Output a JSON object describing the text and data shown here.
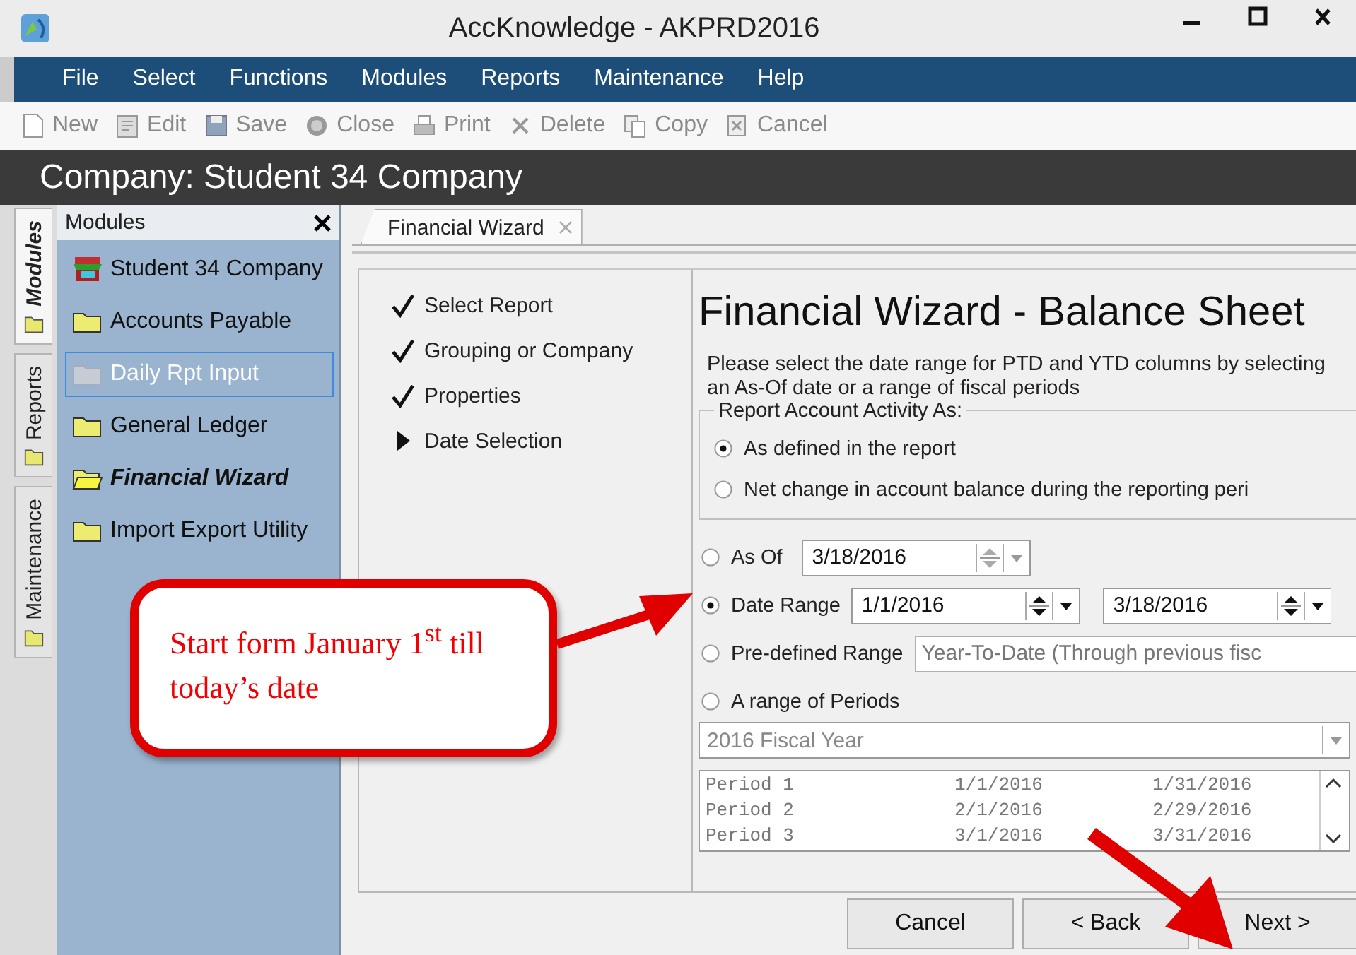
{
  "window": {
    "title": "AccKnowledge - AKPRD2016"
  },
  "menu": [
    "File",
    "Select",
    "Functions",
    "Modules",
    "Reports",
    "Maintenance",
    "Help"
  ],
  "toolbar": [
    {
      "label": "New",
      "kind": "new",
      "disabled": true
    },
    {
      "label": "Edit",
      "kind": "edit",
      "disabled": true
    },
    {
      "label": "Save",
      "kind": "save",
      "disabled": true
    },
    {
      "label": "Close",
      "kind": "close",
      "disabled": true
    },
    {
      "label": "Print",
      "kind": "print",
      "disabled": true
    },
    {
      "label": "Delete",
      "kind": "delete",
      "disabled": true
    },
    {
      "label": "Copy",
      "kind": "copy",
      "disabled": true
    },
    {
      "label": "Cancel",
      "kind": "cancel",
      "disabled": true
    }
  ],
  "company_bar": {
    "text": "Company: Student 34 Company"
  },
  "side_tabs": [
    {
      "label": "Modules",
      "selected": true
    },
    {
      "label": "Reports",
      "selected": false
    },
    {
      "label": "Maintenance",
      "selected": false
    }
  ],
  "sidebar": {
    "title": "Modules",
    "items": [
      {
        "label": "Student 34 Company",
        "kind": "company",
        "disabled": false,
        "selected": false,
        "focused": false
      },
      {
        "label": "Accounts Payable",
        "kind": "module",
        "disabled": false,
        "selected": false,
        "focused": false
      },
      {
        "label": "Daily Rpt Input",
        "kind": "module",
        "disabled": true,
        "selected": false,
        "focused": true
      },
      {
        "label": "General Ledger",
        "kind": "module",
        "disabled": false,
        "selected": false,
        "focused": false
      },
      {
        "label": "Financial Wizard",
        "kind": "module",
        "disabled": false,
        "selected": true,
        "focused": false
      },
      {
        "label": "Import Export Utility",
        "kind": "module",
        "disabled": false,
        "selected": false,
        "focused": false
      }
    ]
  },
  "doc_tab": {
    "label": "Financial Wizard",
    "selected": true
  },
  "steps": [
    {
      "label": "Select Report",
      "kind": "done"
    },
    {
      "label": "Grouping or Company",
      "kind": "done"
    },
    {
      "label": "Properties",
      "kind": "done"
    },
    {
      "label": "Date Selection",
      "kind": "current"
    }
  ],
  "wizard": {
    "title": "Financial Wizard - Balance Sheet",
    "instructions": "Please select the date range for PTD and YTD columns by selecting an As-Of date or a range of fiscal periods",
    "activity": {
      "legend": "Report Account Activity As:",
      "options": [
        {
          "label": "As defined in the report",
          "selected": true
        },
        {
          "label": "Net change in account balance during the reporting peri",
          "selected": false
        }
      ]
    },
    "date_options": [
      {
        "kind": "as_of",
        "label": "As Of",
        "selected": false,
        "value": "3/18/2016"
      },
      {
        "kind": "range",
        "label": "Date Range",
        "selected": true,
        "from": "1/1/2016",
        "to": "3/18/2016"
      },
      {
        "kind": "predefined",
        "label": "Pre-defined Range",
        "selected": false,
        "value": "Year-To-Date (Through previous fisc"
      },
      {
        "kind": "periods",
        "label": "A range of Periods",
        "selected": false
      }
    ],
    "fiscal_year": {
      "value": "2016 Fiscal Year",
      "disabled": true
    },
    "periods": [
      {
        "name": "Period 1",
        "start": "1/1/2016",
        "end": "1/31/2016"
      },
      {
        "name": "Period 2",
        "start": "2/1/2016",
        "end": "2/29/2016"
      },
      {
        "name": "Period 3",
        "start": "3/1/2016",
        "end": "3/31/2016"
      }
    ]
  },
  "buttons": [
    {
      "label": "Cancel"
    },
    {
      "label": "< Back"
    },
    {
      "label": "Next >"
    }
  ],
  "callout": {
    "text": "Start form January 1$^{st}$ till today’s date"
  }
}
